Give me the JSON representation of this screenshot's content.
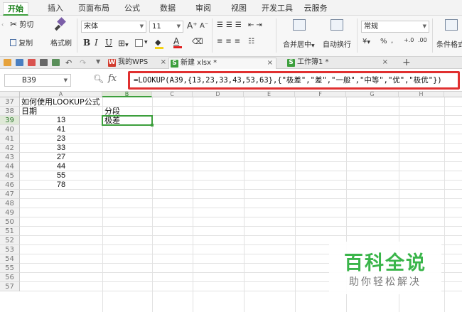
{
  "menu": {
    "tabs": [
      "开始",
      "插入",
      "页面布局",
      "公式",
      "数据",
      "审阅",
      "视图",
      "开发工具",
      "云服务"
    ],
    "active": "开始"
  },
  "ribbon": {
    "cut_label": "剪切",
    "copy_label": "复制",
    "format_painter_label": "格式刷",
    "font_name": "宋体",
    "font_size": "11",
    "bold": "B",
    "italic": "I",
    "underline": "U",
    "grow_font": "A⁺",
    "shrink_font": "A⁻",
    "merge_label": "合并居中",
    "wrap_label": "自动换行",
    "number_format": "常规",
    "currency_symbol": "¥",
    "percent_symbol": "%",
    "comma_symbol": ",",
    "inc_decimal": "+.0",
    "dec_decimal": ".00",
    "cond_format_label": "条件格式"
  },
  "doc_tabs": [
    {
      "label": "我的WPS",
      "icon": "wps-logo-icon",
      "icon_color": "#d23c2e"
    },
    {
      "label": "新建 xlsx *",
      "icon": "spreadsheet-icon",
      "icon_color": "#3c9f3c"
    },
    {
      "label": "工作簿1 *",
      "icon": "spreadsheet-icon",
      "icon_color": "#3c9f3c"
    }
  ],
  "formula_bar": {
    "name_box": "B39",
    "formula": "=LOOKUP(A39,{13,23,33,43,53,63},{\"极差\",\"差\",\"一般\",\"中等\",\"优\",\"极优\"})"
  },
  "sheet": {
    "columns": [
      "A",
      "B",
      "C",
      "D",
      "E",
      "F",
      "G",
      "H"
    ],
    "selected_column": "B",
    "row_numbers": [
      "37",
      "38",
      "39",
      "40",
      "41",
      "42",
      "43",
      "44",
      "45",
      "46",
      "47",
      "48",
      "49",
      "50",
      "51",
      "52",
      "53",
      "54",
      "55",
      "56",
      "57"
    ],
    "selected_row": "39",
    "title_cell": "如何使用LOOKUP公式",
    "header_a": "日期",
    "header_b": "分段",
    "values_a": [
      "13",
      "41",
      "23",
      "33",
      "27",
      "44",
      "55",
      "78"
    ],
    "b39": "极差"
  },
  "watermark": {
    "title": "百科全说",
    "subtitle": "助你轻松解决"
  },
  "colors": {
    "accent_green": "#3c9f3c",
    "highlight_red": "#e03030",
    "watermark_green": "#3ab54a"
  }
}
